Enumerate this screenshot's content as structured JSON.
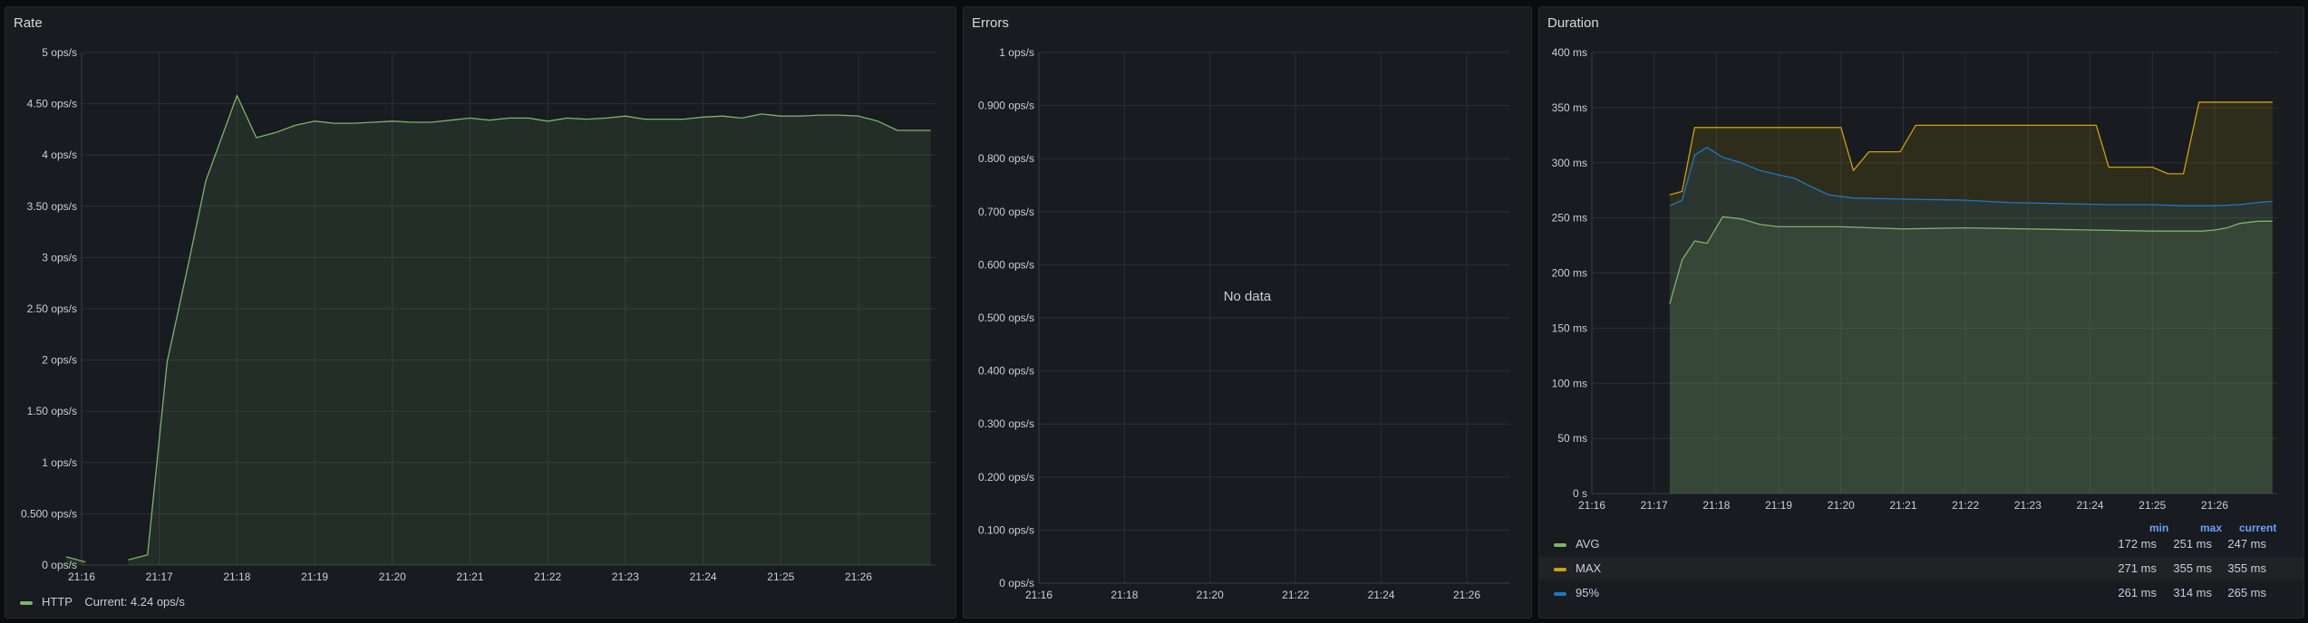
{
  "panels": {
    "rate": {
      "title": "Rate",
      "legend": {
        "series": "HTTP",
        "current_label": "Current: 4.24 ops/s",
        "color": "#7eb26d"
      }
    },
    "errors": {
      "title": "Errors",
      "no_data": "No data"
    },
    "duration": {
      "title": "Duration",
      "legend": {
        "headers": [
          "min",
          "max",
          "current"
        ],
        "rows": [
          {
            "name": "AVG",
            "color": "#7eb26d",
            "min": "172 ms",
            "max": "251 ms",
            "current": "247 ms"
          },
          {
            "name": "MAX",
            "color": "#cca300",
            "min": "271 ms",
            "max": "355 ms",
            "current": "355 ms"
          },
          {
            "name": "95%",
            "color": "#1f78c1",
            "min": "261 ms",
            "max": "314 ms",
            "current": "265 ms"
          }
        ]
      }
    }
  },
  "chart_data": [
    {
      "type": "area",
      "title": "Rate",
      "ylim": [
        0,
        5
      ],
      "yticks": [
        "0 ops/s",
        "0.500 ops/s",
        "1 ops/s",
        "1.50 ops/s",
        "2 ops/s",
        "2.50 ops/s",
        "3 ops/s",
        "3.50 ops/s",
        "4 ops/s",
        "4.50 ops/s",
        "5 ops/s"
      ],
      "xticks": [
        "21:16",
        "21:17",
        "21:18",
        "21:19",
        "21:20",
        "21:21",
        "21:22",
        "21:23",
        "21:24",
        "21:25",
        "21:26"
      ],
      "x_range_min": [
        15.8,
        26.93
      ],
      "grid": true,
      "series": [
        {
          "name": "HTTP",
          "color": "#7eb26d",
          "segments": [
            {
              "x": [
                15.8,
                16.05
              ],
              "y": [
                0.08,
                0.03
              ]
            },
            {
              "x": [
                16.6,
                16.85,
                17.1,
                17.35,
                17.6,
                18.0,
                18.25,
                18.5,
                18.75,
                19.0,
                19.25,
                19.5,
                19.75,
                20.0,
                20.25,
                20.5,
                20.75,
                21.0,
                21.25,
                21.5,
                21.75,
                22.0,
                22.25,
                22.5,
                22.75,
                23.0,
                23.25,
                23.5,
                23.75,
                24.0,
                24.25,
                24.5,
                24.75,
                25.0,
                25.25,
                25.5,
                25.75,
                26.0,
                26.25,
                26.5,
                26.75,
                26.93
              ],
              "y": [
                0.05,
                0.1,
                1.98,
                2.85,
                3.75,
                4.58,
                4.17,
                4.22,
                4.29,
                4.33,
                4.31,
                4.31,
                4.32,
                4.33,
                4.32,
                4.32,
                4.34,
                4.36,
                4.34,
                4.36,
                4.36,
                4.33,
                4.36,
                4.35,
                4.36,
                4.38,
                4.35,
                4.35,
                4.35,
                4.37,
                4.38,
                4.36,
                4.4,
                4.38,
                4.38,
                4.39,
                4.39,
                4.38,
                4.33,
                4.24,
                4.24,
                4.24
              ]
            }
          ]
        }
      ]
    },
    {
      "type": "line",
      "title": "Errors",
      "ylim": [
        0,
        1
      ],
      "yticks": [
        "0 ops/s",
        "0.100 ops/s",
        "0.200 ops/s",
        "0.300 ops/s",
        "0.400 ops/s",
        "0.500 ops/s",
        "0.600 ops/s",
        "0.700 ops/s",
        "0.800 ops/s",
        "0.900 ops/s",
        "1 ops/s"
      ],
      "xticks": [
        "21:16",
        "21:18",
        "21:20",
        "21:22",
        "21:24",
        "21:26"
      ],
      "grid": true,
      "series": []
    },
    {
      "type": "area",
      "title": "Duration",
      "ylim": [
        0,
        400
      ],
      "yticks": [
        "0 s",
        "50 ms",
        "100 ms",
        "150 ms",
        "200 ms",
        "250 ms",
        "300 ms",
        "350 ms",
        "400 ms"
      ],
      "xticks": [
        "21:16",
        "21:17",
        "21:18",
        "21:19",
        "21:20",
        "21:21",
        "21:22",
        "21:23",
        "21:24",
        "21:25",
        "21:26"
      ],
      "grid": true,
      "series": [
        {
          "name": "MAX",
          "color": "#cca300",
          "x": [
            17.25,
            17.45,
            17.65,
            19.3,
            20.0,
            20.2,
            20.45,
            20.95,
            21.2,
            22.0,
            23.0,
            23.95,
            24.1,
            24.3,
            25.0,
            25.25,
            25.5,
            25.75,
            26.93
          ],
          "y": [
            271,
            274,
            332,
            332,
            332,
            293,
            310,
            310,
            334,
            334,
            334,
            334,
            334,
            296,
            296,
            290,
            290,
            355,
            355
          ]
        },
        {
          "name": "95%",
          "color": "#1f78c1",
          "x": [
            17.25,
            17.45,
            17.65,
            17.85,
            18.1,
            18.4,
            18.7,
            19.0,
            19.25,
            19.5,
            19.8,
            20.2,
            21.0,
            22.0,
            22.7,
            23.5,
            24.3,
            25.0,
            25.5,
            26.0,
            26.4,
            26.7,
            26.93
          ],
          "y": [
            261,
            266,
            307,
            314,
            305,
            300,
            293,
            289,
            286,
            279,
            271,
            268,
            267,
            266,
            264,
            263,
            262,
            262,
            261,
            261,
            262,
            264,
            265
          ]
        },
        {
          "name": "AVG",
          "color": "#7eb26d",
          "x": [
            17.25,
            17.45,
            17.65,
            17.85,
            18.1,
            18.4,
            18.7,
            19.0,
            19.5,
            20.0,
            20.5,
            21.0,
            22.0,
            23.0,
            24.0,
            25.0,
            25.5,
            25.8,
            26.0,
            26.2,
            26.4,
            26.7,
            26.93
          ],
          "y": [
            172,
            212,
            229,
            227,
            251,
            249,
            244,
            242,
            242,
            242,
            241,
            240,
            241,
            240,
            239,
            238,
            238,
            238,
            239,
            241,
            245,
            247,
            247
          ]
        }
      ]
    }
  ]
}
